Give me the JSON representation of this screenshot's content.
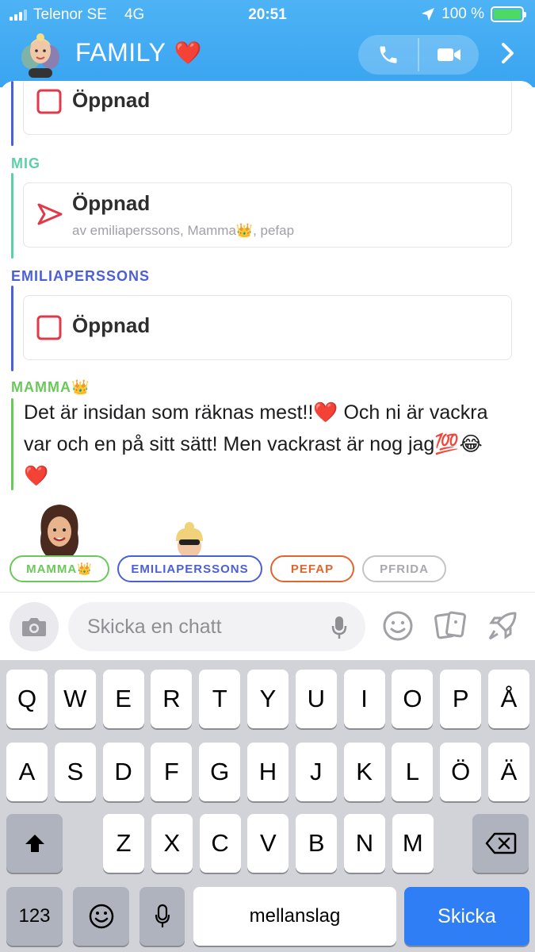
{
  "status_bar": {
    "carrier": "Telenor SE",
    "network": "4G",
    "time": "20:51",
    "battery_percent": "100 %",
    "battery_level": 1.0
  },
  "header": {
    "title": "FAMILY",
    "title_emoji": "❤️",
    "call_icon": "phone-icon",
    "video_icon": "video-icon",
    "more_icon": "chevron-right-icon"
  },
  "messages": [
    {
      "sender": "",
      "status": "Öppnad",
      "type": "received-snap",
      "color": "#4b5fd6"
    },
    {
      "sender": "MIG",
      "status": "Öppnad",
      "type": "sent-snap",
      "subtitle": "av emiliaperssons, Mamma👑, pefap",
      "color": "#5dd0a6"
    },
    {
      "sender": "EMILIAPERSSONS",
      "status": "Öppnad",
      "type": "received-snap",
      "color": "#4b5fd6"
    },
    {
      "sender": "MAMMA👑",
      "type": "text",
      "text": "Det är insidan som räknas mest!!❤️ Och ni är vackra var och en på sitt sätt! Men vackrast är nog jag💯😂❤️",
      "color": "#6bc85a"
    }
  ],
  "members": [
    {
      "name": "MAMMA👑",
      "color": "#6bc85a"
    },
    {
      "name": "EMILIAPERSSONS",
      "color": "#4b5fd6"
    },
    {
      "name": "PEFAP",
      "color": "#e3652e"
    },
    {
      "name": "PFRIDA",
      "color": "#a8a8ad"
    }
  ],
  "input": {
    "placeholder": "Skicka en chatt"
  },
  "keyboard": {
    "row1": [
      "Q",
      "W",
      "E",
      "R",
      "T",
      "Y",
      "U",
      "I",
      "O",
      "P",
      "Å"
    ],
    "row2": [
      "A",
      "S",
      "D",
      "F",
      "G",
      "H",
      "J",
      "K",
      "L",
      "Ö",
      "Ä"
    ],
    "row3": [
      "Z",
      "X",
      "C",
      "V",
      "B",
      "N",
      "M"
    ],
    "numbers_key": "123",
    "space_key": "mellanslag",
    "send_key": "Skicka"
  }
}
